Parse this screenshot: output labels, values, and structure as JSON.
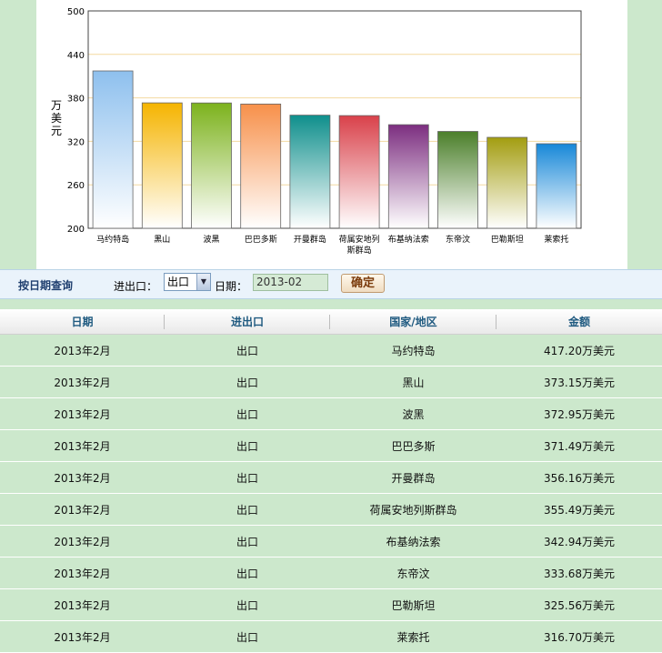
{
  "chart_data": {
    "type": "bar",
    "ylabel": "万美元",
    "ylim": [
      200,
      500
    ],
    "yticks": [
      200,
      260,
      320,
      380,
      440,
      500
    ],
    "grid": true,
    "categories": [
      "马约特岛",
      "黑山",
      "波黑",
      "巴巴多斯",
      "开曼群岛",
      "荷属安地列斯群岛",
      "布基纳法索",
      "东帝汶",
      "巴勒斯坦",
      "莱索托"
    ],
    "category_labels": [
      [
        "马约特岛"
      ],
      [
        "黑山"
      ],
      [
        "波黑"
      ],
      [
        "巴巴多斯"
      ],
      [
        "开曼群岛"
      ],
      [
        "荷属安地列",
        "斯群岛"
      ],
      [
        "布基纳法索"
      ],
      [
        "东帝汶"
      ],
      [
        "巴勒斯坦"
      ],
      [
        "莱索托"
      ]
    ],
    "values": [
      417.2,
      373.15,
      372.95,
      371.49,
      356.16,
      355.49,
      342.94,
      333.68,
      325.56,
      316.7
    ],
    "colors": [
      "#8ec0ee",
      "#f5b400",
      "#7cb21c",
      "#f7904a",
      "#0f8f8c",
      "#d9414a",
      "#7c2e80",
      "#4b7f2a",
      "#a39d10",
      "#1888d8"
    ]
  },
  "query": {
    "title": "按日期查询",
    "direction_label": "进出口：",
    "direction_value": "出口",
    "date_label": "日期：",
    "date_value": "2013-02",
    "confirm_label": "确定"
  },
  "table": {
    "headers": [
      "日期",
      "进出口",
      "国家/地区",
      "金额"
    ],
    "rows": [
      [
        "2013年2月",
        "出口",
        "马约特岛",
        "417.20万美元"
      ],
      [
        "2013年2月",
        "出口",
        "黑山",
        "373.15万美元"
      ],
      [
        "2013年2月",
        "出口",
        "波黑",
        "372.95万美元"
      ],
      [
        "2013年2月",
        "出口",
        "巴巴多斯",
        "371.49万美元"
      ],
      [
        "2013年2月",
        "出口",
        "开曼群岛",
        "356.16万美元"
      ],
      [
        "2013年2月",
        "出口",
        "荷属安地列斯群岛",
        "355.49万美元"
      ],
      [
        "2013年2月",
        "出口",
        "布基纳法索",
        "342.94万美元"
      ],
      [
        "2013年2月",
        "出口",
        "东帝汶",
        "333.68万美元"
      ],
      [
        "2013年2月",
        "出口",
        "巴勒斯坦",
        "325.56万美元"
      ],
      [
        "2013年2月",
        "出口",
        "莱索托",
        "316.70万美元"
      ]
    ]
  }
}
